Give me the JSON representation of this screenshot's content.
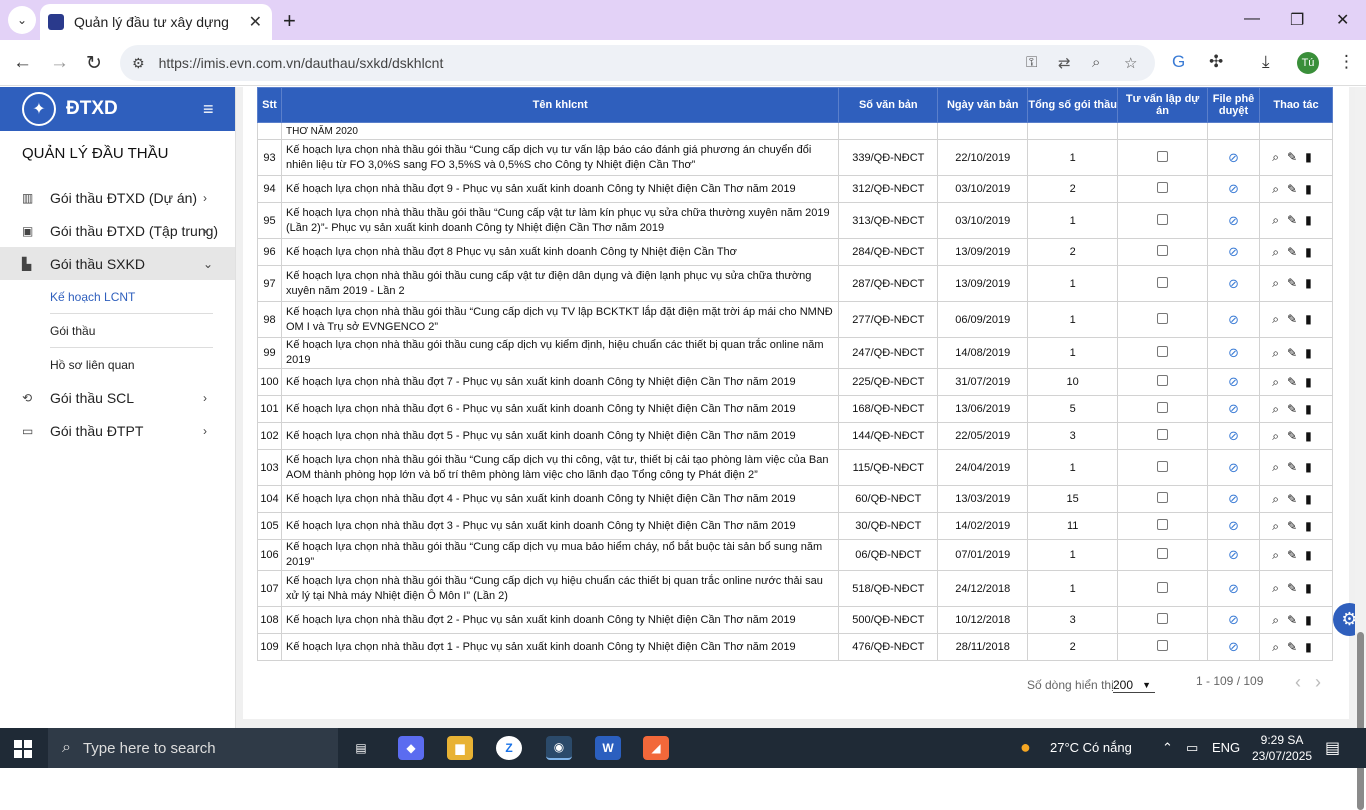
{
  "browser": {
    "tab_title": "Quản lý đầu tư xây dựng",
    "url": "https://imis.evn.com.vn/dauthau/sxkd/dskhlcnt",
    "profile_initial": "Tú"
  },
  "sidebar": {
    "brand": "ĐTXD",
    "section_title": "QUẢN LÝ ĐẦU THẦU",
    "items": [
      {
        "label": "Gói thầu ĐTXD (Dự án)"
      },
      {
        "label": "Gói thầu ĐTXD (Tập trung)"
      },
      {
        "label": "Gói thầu SXKD"
      },
      {
        "label": "Gói thầu SCL"
      },
      {
        "label": "Gói thầu ĐTPT"
      }
    ],
    "sub_items": [
      {
        "label": "Kế hoạch LCNT"
      },
      {
        "label": "Gói thầu"
      },
      {
        "label": "Hồ sơ liên quan"
      }
    ]
  },
  "table": {
    "headers": [
      "Stt",
      "Tên khlcnt",
      "Số văn bản",
      "Ngày văn bản",
      "Tổng số gói thầu",
      "Tư vấn lập dự án",
      "File phê duyệt",
      "Thao tác"
    ],
    "partial_row_text": "THƠ NĂM 2020",
    "rows": [
      {
        "stt": "93",
        "name": "Kế hoạch lựa chọn nhà thầu gói thầu “Cung cấp dịch vụ tư vấn lập báo cáo đánh giá phương án chuyển đổi nhiên liệu từ FO 3,0%S sang FO 3,5%S và 0,5%S cho Công ty Nhiệt điện Cần Thơ”",
        "so": "339/QĐ-NĐCT",
        "ngay": "22/10/2019",
        "tong": "1"
      },
      {
        "stt": "94",
        "name": "Kế hoạch lựa chọn nhà thầu đợt 9 - Phục vụ sản xuất kinh doanh Công ty Nhiệt điện Cần Thơ năm 2019",
        "so": "312/QĐ-NĐCT",
        "ngay": "03/10/2019",
        "tong": "2"
      },
      {
        "stt": "95",
        "name": "Kế hoạch lựa chọn nhà thầu thầu gói thầu “Cung cấp vật tư làm kín phục vụ sửa chữa thường xuyên năm 2019 (Lần 2)”- Phục vụ sản xuất kinh doanh Công ty Nhiệt điện Cần Thơ năm 2019",
        "so": "313/QĐ-NĐCT",
        "ngay": "03/10/2019",
        "tong": "1"
      },
      {
        "stt": "96",
        "name": "Kế hoạch lựa chọn nhà thầu đợt 8 Phục vụ sản xuất kinh doanh Công ty Nhiệt điện Cần Thơ",
        "so": "284/QĐ-NĐCT",
        "ngay": "13/09/2019",
        "tong": "2"
      },
      {
        "stt": "97",
        "name": "Kế hoạch lựa chọn nhà thầu gói thầu cung cấp vật tư điện dân dụng và điện lạnh phục vụ sửa chữa thường xuyên năm 2019 - Lần 2",
        "so": "287/QĐ-NĐCT",
        "ngay": "13/09/2019",
        "tong": "1"
      },
      {
        "stt": "98",
        "name": "Kế hoạch lựa chọn nhà thầu gói thầu “Cung cấp dịch vụ TV lập BCKTKT lắp đặt điện mặt trời áp mái cho NMNĐ OM I và Trụ sở EVNGENCO 2”",
        "so": "277/QĐ-NĐCT",
        "ngay": "06/09/2019",
        "tong": "1"
      },
      {
        "stt": "99",
        "name": "Kế hoạch lựa chọn nhà thầu gói thầu cung cấp dịch vụ kiểm định, hiệu chuẩn các thiết bị quan trắc online năm 2019",
        "so": "247/QĐ-NĐCT",
        "ngay": "14/08/2019",
        "tong": "1"
      },
      {
        "stt": "100",
        "name": "Kế hoạch lựa chọn nhà thầu đợt 7 - Phục vụ sản xuất kinh doanh Công ty Nhiệt điện Cần Thơ năm 2019",
        "so": "225/QĐ-NĐCT",
        "ngay": "31/07/2019",
        "tong": "10"
      },
      {
        "stt": "101",
        "name": "Kế hoạch lựa chọn nhà thầu đợt 6 - Phục vụ sản xuất kinh doanh Công ty Nhiệt điện Cần Thơ năm 2019",
        "so": "168/QĐ-NĐCT",
        "ngay": "13/06/2019",
        "tong": "5"
      },
      {
        "stt": "102",
        "name": "Kế hoạch lựa chọn nhà thầu đợt 5 - Phục vụ sản xuất kinh doanh Công ty Nhiệt điện Cần Thơ năm 2019",
        "so": "144/QĐ-NĐCT",
        "ngay": "22/05/2019",
        "tong": "3"
      },
      {
        "stt": "103",
        "name": "Kế hoạch lựa chọn nhà thầu gói thầu “Cung cấp dịch vụ thi công, vật tư, thiết bị cải tạo phòng làm việc của Ban AOM thành phòng họp lớn và bố trí thêm phòng làm việc cho lãnh đạo Tổng công ty Phát điện 2”",
        "so": "115/QĐ-NĐCT",
        "ngay": "24/04/2019",
        "tong": "1"
      },
      {
        "stt": "104",
        "name": "Kế hoạch lựa chọn nhà thầu đợt 4 - Phục vụ sản xuất kinh doanh Công ty Nhiệt điện Cần Thơ năm 2019",
        "so": "60/QĐ-NĐCT",
        "ngay": "13/03/2019",
        "tong": "15"
      },
      {
        "stt": "105",
        "name": "Kế hoạch lựa chọn nhà thầu đợt 3 - Phục vụ sản xuất kinh doanh Công ty Nhiệt điện Cần Thơ năm 2019",
        "so": "30/QĐ-NĐCT",
        "ngay": "14/02/2019",
        "tong": "11"
      },
      {
        "stt": "106",
        "name": "Kế hoạch lựa chọn nhà thầu gói thầu “Cung cấp dịch vụ mua bảo hiểm cháy, nổ bắt buộc tài sản bổ sung năm 2019”",
        "so": "06/QĐ-NĐCT",
        "ngay": "07/01/2019",
        "tong": "1"
      },
      {
        "stt": "107",
        "name": "Kế hoạch lựa chọn nhà thầu gói thầu “Cung cấp dịch vụ hiệu chuẩn các thiết bị quan trắc online nước thải sau xử lý tại Nhà máy Nhiệt điện Ô Môn I” (Lần 2)",
        "so": "518/QĐ-NĐCT",
        "ngay": "24/12/2018",
        "tong": "1"
      },
      {
        "stt": "108",
        "name": "Kế hoạch lựa chọn nhà thầu đợt 2 - Phục vụ sản xuất kinh doanh Công ty Nhiệt điện Cần Thơ năm 2019",
        "so": "500/QĐ-NĐCT",
        "ngay": "10/12/2018",
        "tong": "3"
      },
      {
        "stt": "109",
        "name": "Kế hoạch lựa chọn nhà thầu đợt 1 - Phục vụ sản xuất kinh doanh Công ty Nhiệt điện Cần Thơ năm 2019",
        "so": "476/QĐ-NĐCT",
        "ngay": "28/11/2018",
        "tong": "2"
      }
    ]
  },
  "pager": {
    "rows_label": "Số dòng hiển thị",
    "rows_value": "200",
    "range": "1 - 109 / 109"
  },
  "taskbar": {
    "search_placeholder": "Type here to search",
    "weather": "27°C  Có nắng",
    "lang": "ENG",
    "time": "9:29 SA",
    "date": "23/07/2025"
  }
}
